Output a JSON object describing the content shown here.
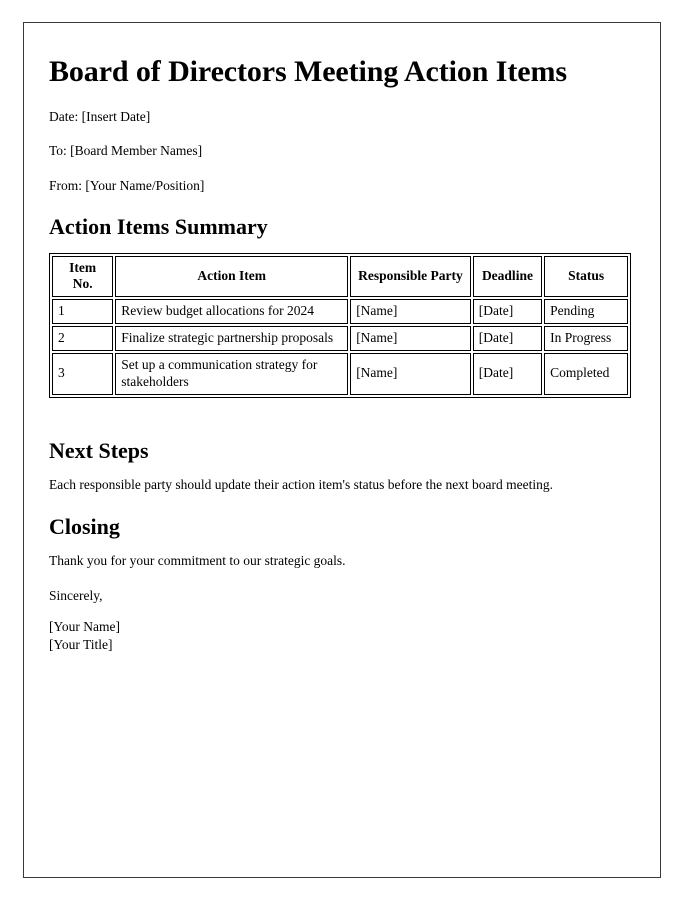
{
  "document": {
    "title": "Board of Directors Meeting Action Items",
    "meta": {
      "date_line": "Date: [Insert Date]",
      "to_line": "To: [Board Member Names]",
      "from_line": "From: [Your Name/Position]"
    },
    "sections": {
      "summary_heading": "Action Items Summary",
      "next_steps_heading": "Next Steps",
      "next_steps_body": "Each responsible party should update their action item's status before the next board meeting.",
      "closing_heading": "Closing",
      "closing_body": "Thank you for your commitment to our strategic goals.",
      "sign_off": "Sincerely,",
      "signature_name": "[Your Name]",
      "signature_title": "[Your Title]"
    },
    "table": {
      "headers": [
        "Item No.",
        "Action Item",
        "Responsible Party",
        "Deadline",
        "Status"
      ],
      "rows": [
        {
          "item_no": "1",
          "action_item": "Review budget allocations for 2024",
          "responsible_party": "[Name]",
          "deadline": "[Date]",
          "status": "Pending"
        },
        {
          "item_no": "2",
          "action_item": "Finalize strategic partnership proposals",
          "responsible_party": "[Name]",
          "deadline": "[Date]",
          "status": "In Progress"
        },
        {
          "item_no": "3",
          "action_item": "Set up a communication strategy for stakeholders",
          "responsible_party": "[Name]",
          "deadline": "[Date]",
          "status": "Completed"
        }
      ]
    }
  },
  "colors": {
    "page_border": "#3a3a3a",
    "text": "#000000",
    "table_border": "#000000",
    "background": "#ffffff"
  }
}
